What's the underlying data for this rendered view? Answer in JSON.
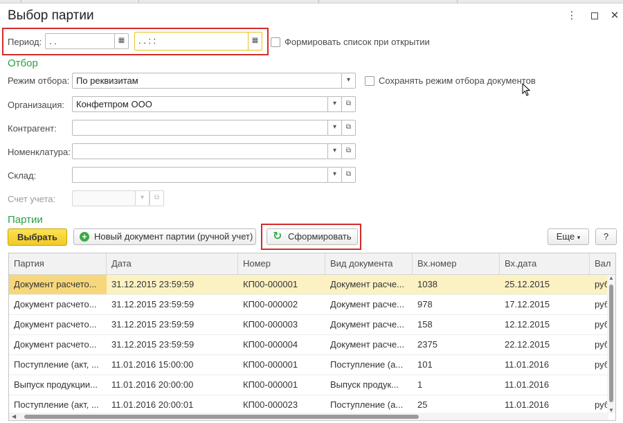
{
  "window": {
    "title": "Выбор партии"
  },
  "period": {
    "label": "Период:",
    "start_value": " .  .",
    "end_value": " .  .       :  :",
    "auto_form_label": "Формировать список при открытии"
  },
  "filter": {
    "section_title": "Отбор",
    "mode_label": "Режим отбора:",
    "mode_value": "По реквизитам",
    "save_mode_label": "Сохранять режим отбора документов",
    "org_label": "Организация:",
    "org_value": "Конфетпром ООО",
    "counterparty_label": "Контрагент:",
    "counterparty_value": "",
    "nomenclature_label": "Номенклатура:",
    "nomenclature_value": "",
    "warehouse_label": "Склад:",
    "warehouse_value": "",
    "account_label": "Счет учета:",
    "account_value": ""
  },
  "batches": {
    "section_title": "Партии",
    "select_label": "Выбрать",
    "new_doc_label": "Новый документ партии (ручной учет)",
    "form_label": "Сформировать",
    "more_label": "Еще",
    "help_label": "?"
  },
  "table": {
    "columns": [
      "Партия",
      "Дата",
      "Номер",
      "Вид документа",
      "Вх.номер",
      "Вх.дата",
      "Вал"
    ],
    "rows": [
      [
        "Документ расчето...",
        "31.12.2015 23:59:59",
        "КП00-000001",
        "Документ расче...",
        "1038",
        "25.12.2015",
        "руб"
      ],
      [
        "Документ расчето...",
        "31.12.2015 23:59:59",
        "КП00-000002",
        "Документ расче...",
        "978",
        "17.12.2015",
        "руб"
      ],
      [
        "Документ расчето...",
        "31.12.2015 23:59:59",
        "КП00-000003",
        "Документ расче...",
        "158",
        "12.12.2015",
        "руб"
      ],
      [
        "Документ расчето...",
        "31.12.2015 23:59:59",
        "КП00-000004",
        "Документ расче...",
        "2375",
        "22.12.2015",
        "руб"
      ],
      [
        "Поступление (акт, ...",
        "11.01.2016 15:00:00",
        "КП00-000001",
        "Поступление (а...",
        "101",
        "11.01.2016",
        "руб"
      ],
      [
        "Выпуск продукции...",
        "11.01.2016 20:00:00",
        "КП00-000001",
        "Выпуск продук...",
        "1",
        "11.01.2016",
        ""
      ],
      [
        "Поступление (акт, ...",
        "11.01.2016 20:00:01",
        "КП00-000023",
        "Поступление (а...",
        "25",
        "11.01.2016",
        "руб"
      ]
    ],
    "selected_row": 0
  },
  "colors": {
    "accent_green": "#2aa043",
    "highlight_red": "#d42a2a",
    "selected_row": "#fbf1c2",
    "button_yellow": "#f2c924"
  }
}
